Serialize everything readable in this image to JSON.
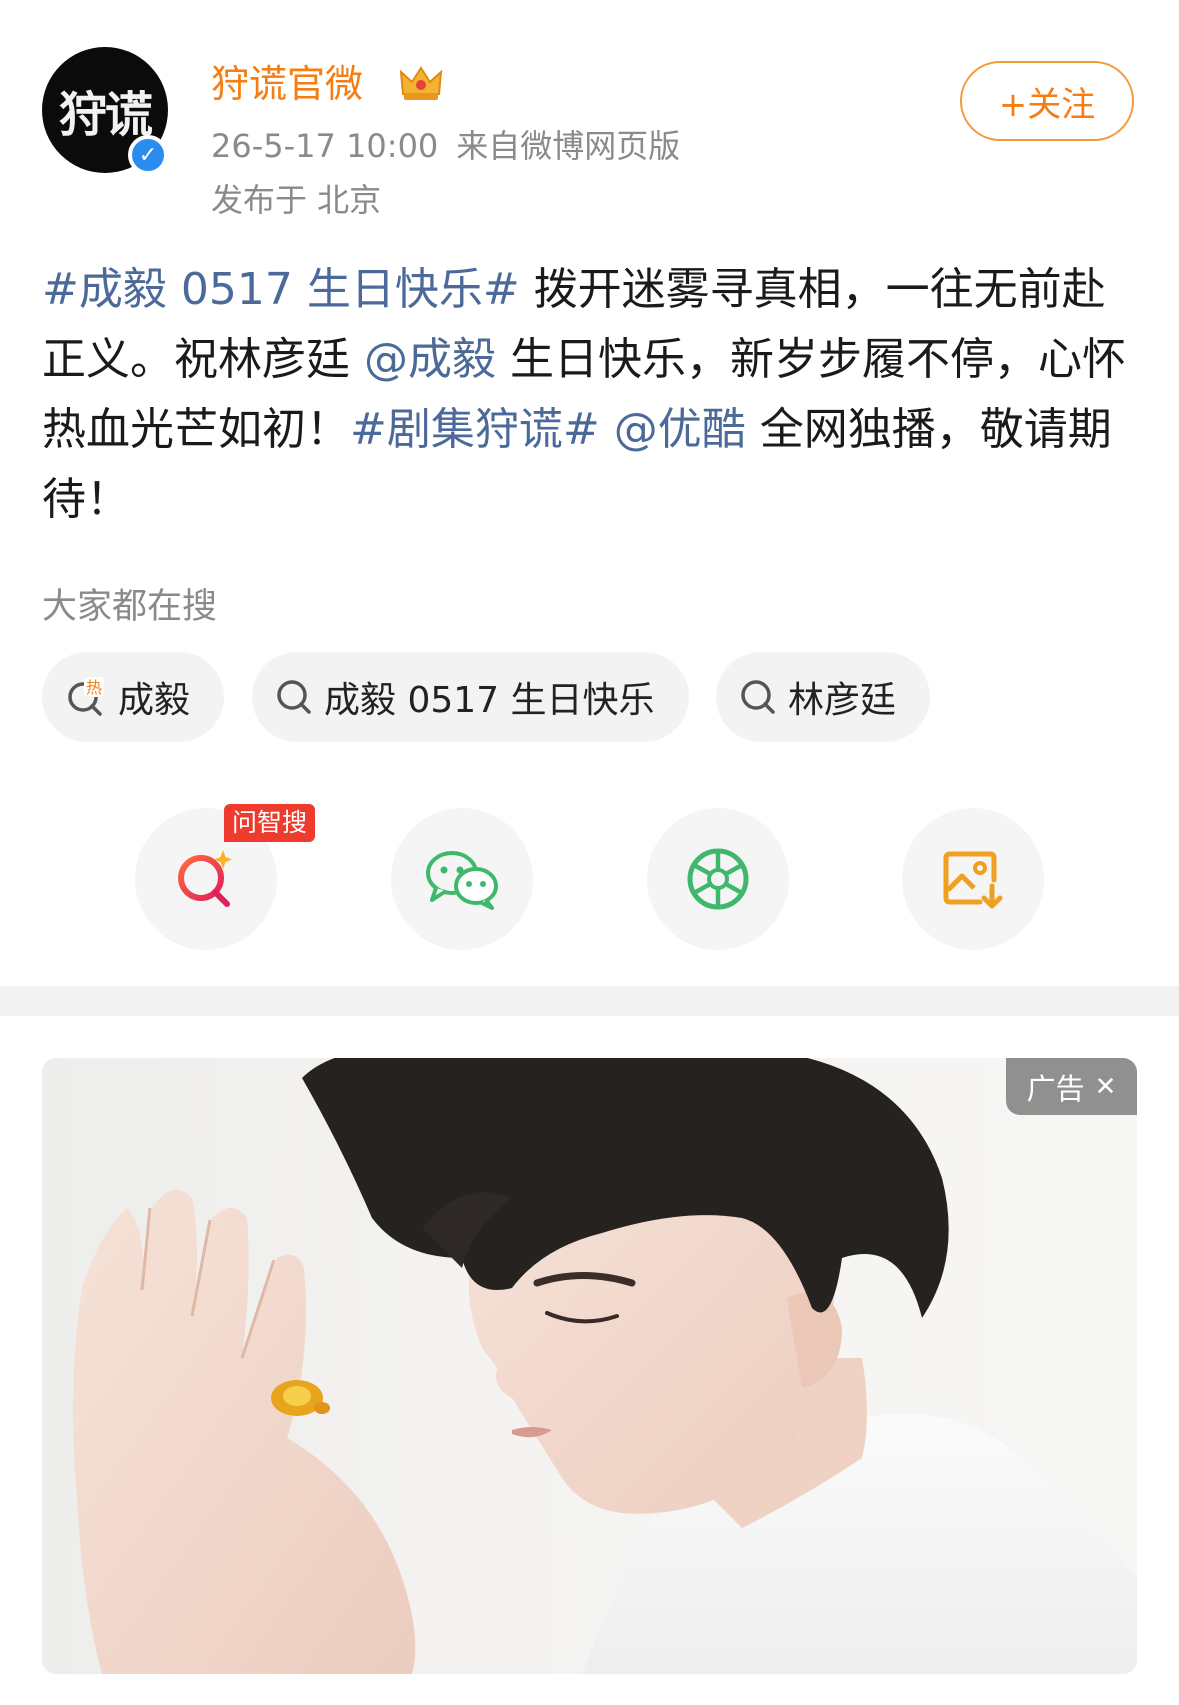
{
  "header": {
    "avatar_text": "狩谎",
    "username": "狩谎官微",
    "timestamp": "26-5-17 10:00",
    "source": "来自微博网页版",
    "location": "发布于 北京",
    "follow_label": "+关注"
  },
  "post": {
    "hashtag1": "#成毅 0517 生日快乐#",
    "text1": " 拨开迷雾寻真相，一往无前赴正义。祝林彦廷",
    "mention1": "@成毅",
    "text2": " 生日快乐，新岁步履不停，心怀热血光芒如初！",
    "hashtag2": "#剧集狩谎#",
    "mention2": "@优酷",
    "text3": " 全网独播，敬请期待！"
  },
  "hot_search": {
    "title": "大家都在搜",
    "chips": [
      {
        "label": "成毅",
        "icon": "hot-search-icon",
        "hot_char": "热"
      },
      {
        "label": "成毅 0517 生日快乐",
        "icon": "search-icon"
      },
      {
        "label": "林彦廷",
        "icon": "search-icon"
      }
    ]
  },
  "actions": {
    "ai_badge": "问智搜",
    "items": [
      {
        "icon": "ai-search-icon"
      },
      {
        "icon": "wechat-icon"
      },
      {
        "icon": "moments-icon"
      },
      {
        "icon": "save-image-icon"
      }
    ]
  },
  "ad": {
    "tag_label": "广告",
    "close_glyph": "✕"
  },
  "colors": {
    "username": "#f57d11",
    "link": "#4c6a99",
    "wechat": "#3fb86b",
    "ai_red": "#ef3a2e",
    "save_orange": "#f0a020"
  }
}
